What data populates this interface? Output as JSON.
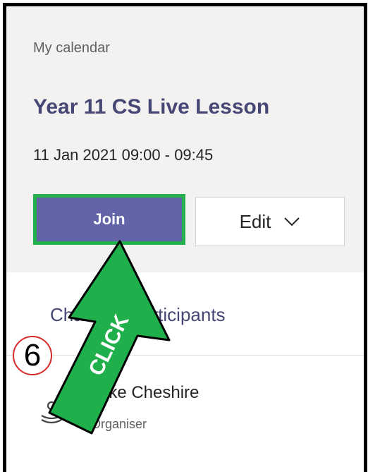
{
  "calendar": {
    "label": "My calendar"
  },
  "meeting": {
    "title": "Year 11 CS Live Lesson",
    "time": "11 Jan 2021 09:00 - 09:45"
  },
  "actions": {
    "join_label": "Join",
    "edit_label": "Edit"
  },
  "chat": {
    "label": "Chat with participants"
  },
  "organiser": {
    "name": "Mike Cheshire",
    "role": "Organiser"
  },
  "annotation": {
    "step": "6",
    "arrow_text": "CLICK"
  },
  "colors": {
    "accent": "#6264a7",
    "highlight": "#22b14c",
    "arrow": "#1faf4b",
    "step_circle": "#d62b2b"
  }
}
